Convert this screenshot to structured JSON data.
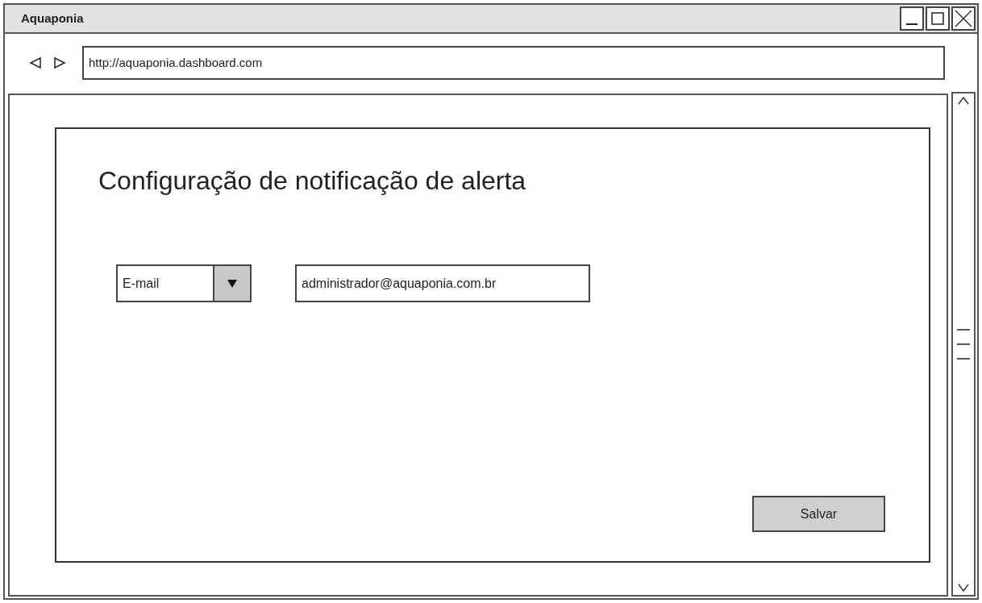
{
  "window": {
    "title": "Aquaponia"
  },
  "address_bar": {
    "url": "http://aquaponia.dashboard.com"
  },
  "page": {
    "heading": "Configuração de notificação de alerta",
    "channel_select": {
      "value": "E-mail"
    },
    "address_field": {
      "value": "administrador@aquaponia.com.br"
    },
    "buttons": [
      "Salvar"
    ]
  }
}
